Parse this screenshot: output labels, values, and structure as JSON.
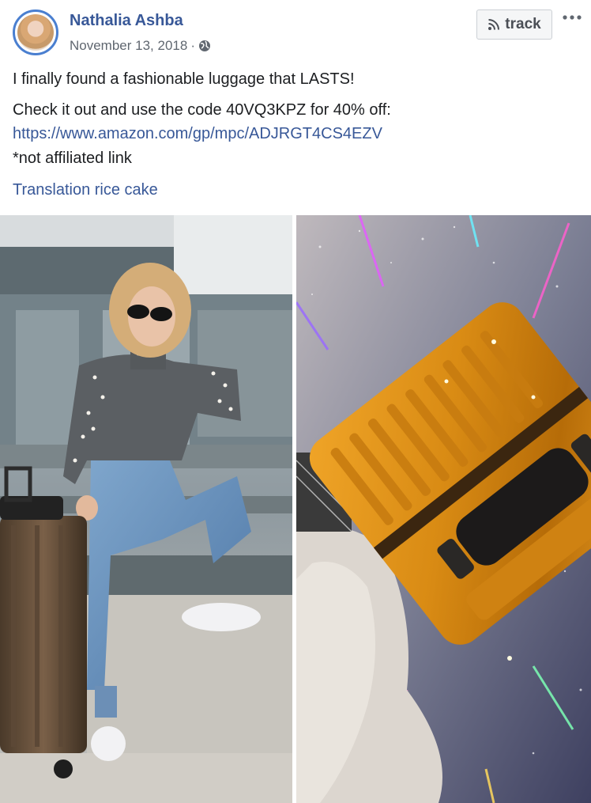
{
  "post": {
    "author": "Nathalia Ashba",
    "date": "November 13, 2018",
    "date_separator": "·",
    "privacy_icon": "globe-icon",
    "track_button": {
      "icon": "rss-icon",
      "label": "track"
    },
    "more_icon": "more-options-icon",
    "text_lines": [
      "I finally found a fashionable luggage that LASTS!",
      "Check it out and use the code 40VQ3KPZ for 40% off:",
      "*not affiliated link"
    ],
    "link": "https://www.amazon.com/gp/mpc/ADJRGT4CS4EZV",
    "translation_link": "Translation rice cake",
    "photos": [
      {
        "description": "woman in gray sweater and jeans posing by brown suitcase"
      },
      {
        "description": "gold suitcase on sparkly background with fleece coat"
      }
    ],
    "colors": {
      "link": "#385898",
      "meta": "#606770",
      "avatar_ring": "#4a7fd0"
    }
  }
}
